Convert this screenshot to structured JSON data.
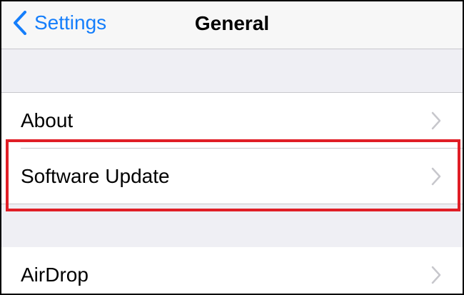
{
  "navbar": {
    "back_label": "Settings",
    "title": "General"
  },
  "rows": [
    {
      "label": "About",
      "icon": "chevron-right-icon"
    },
    {
      "label": "Software Update",
      "icon": "chevron-right-icon",
      "highlighted": true
    },
    {
      "label": "AirDrop",
      "icon": "chevron-right-icon"
    }
  ],
  "colors": {
    "accent": "#157efb",
    "group_background": "#efeff4",
    "separator": "#c8c7cc",
    "chevron": "#c7c7cc",
    "highlight": "#e01e26"
  }
}
